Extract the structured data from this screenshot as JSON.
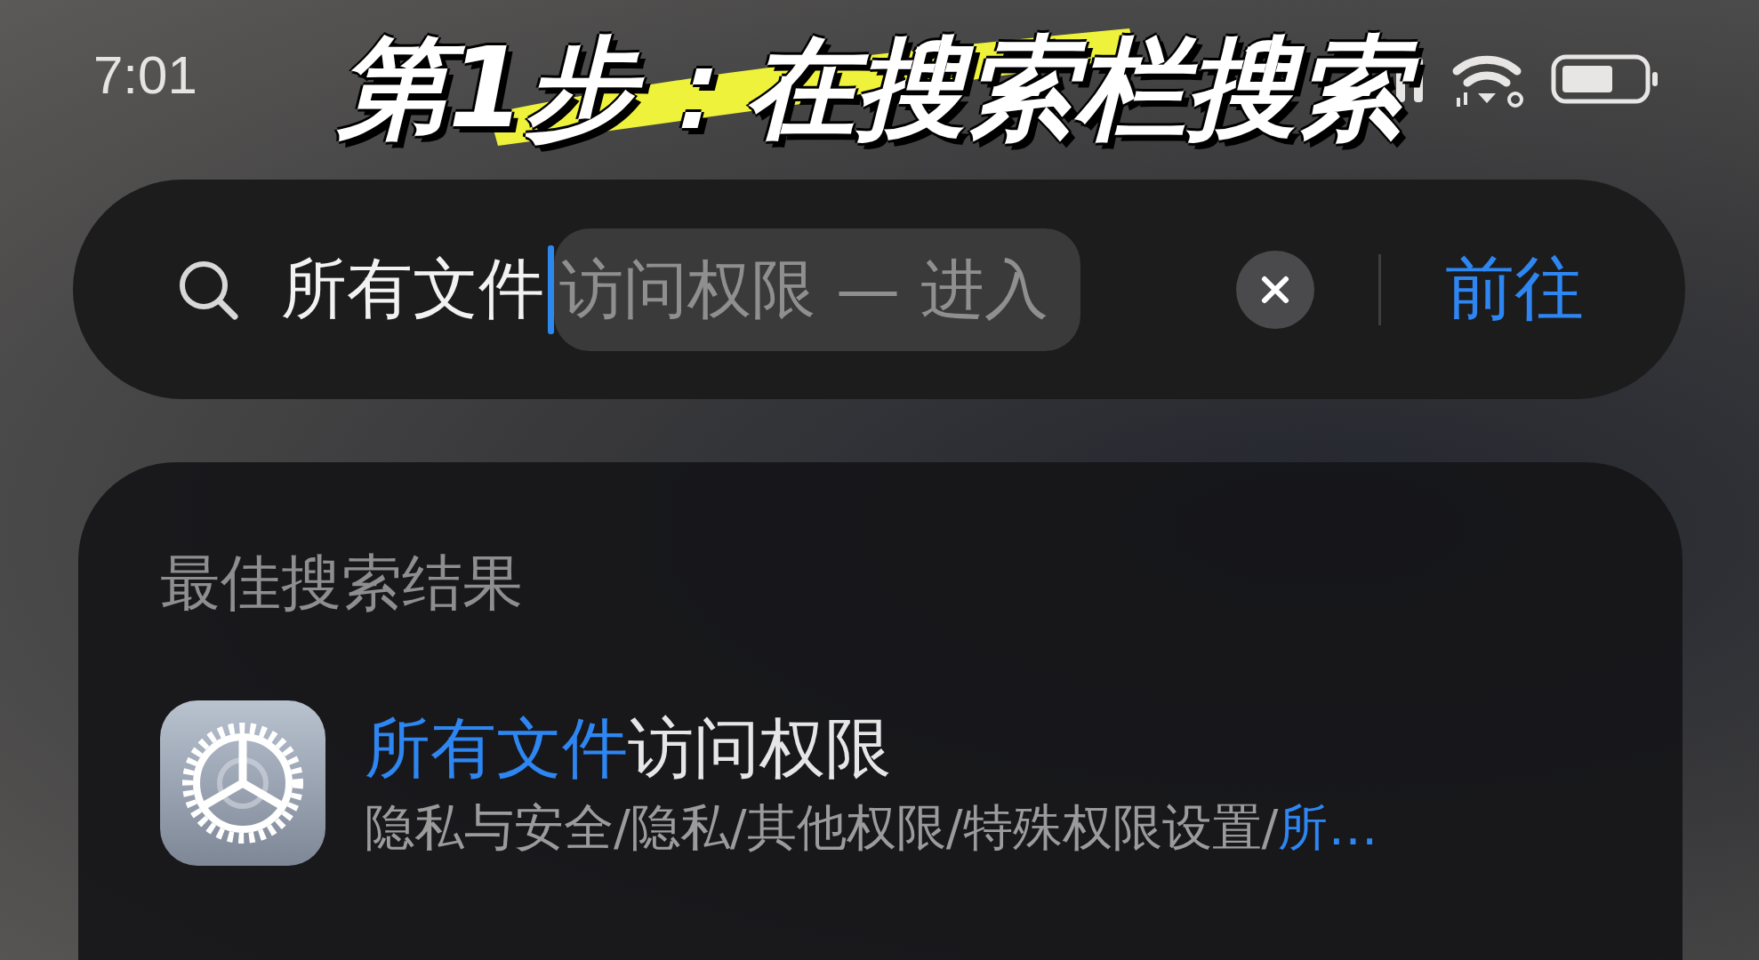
{
  "status_bar": {
    "time": "7:01"
  },
  "caption": "第1步：在搜索栏搜索",
  "search": {
    "value": "所有文件",
    "suggestion": "访问权限 — 进入",
    "go_button": "前往"
  },
  "results": {
    "heading": "最佳搜索结果",
    "items": [
      {
        "title": [
          {
            "text": "所有文件",
            "highlight": true
          },
          {
            "text": "访问权限",
            "highlight": false
          }
        ],
        "path": [
          {
            "text": "隐私与安全/隐私/其他权限/特殊权限设置/",
            "highlight": false
          },
          {
            "text": "所…",
            "highlight": true
          }
        ]
      }
    ]
  }
}
